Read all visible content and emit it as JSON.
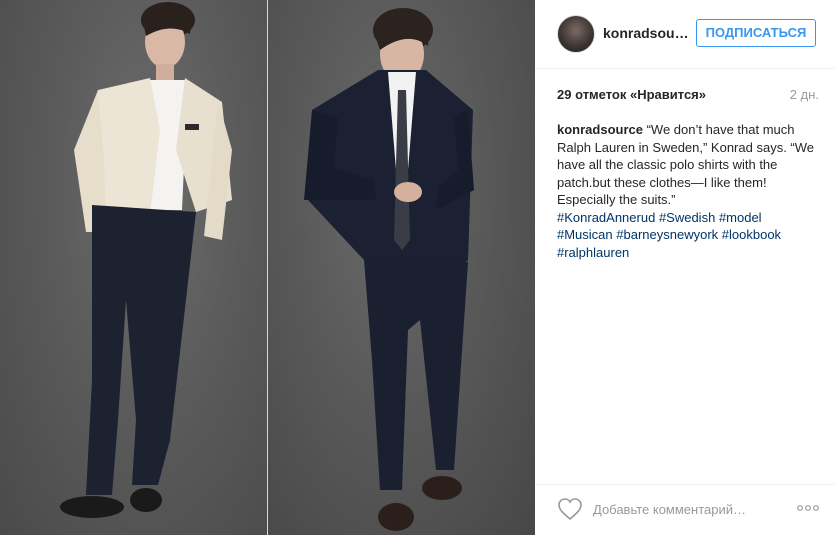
{
  "post": {
    "photo": {
      "description_left": "model-in-cream-blazer",
      "description_right": "model-in-navy-suit"
    }
  },
  "header": {
    "username": "konradsou…",
    "follow_label": "ПОДПИСАТЬСЯ"
  },
  "stats": {
    "likes": "29 отметок «Нравится»",
    "age": "2 дн."
  },
  "caption": {
    "user": "konradsource",
    "text": " “We don’t have that much Ralph Lauren in Sweden,” Konrad says. “We have all the classic polo shirts with the patch.but these clothes—I like them! Especially the suits.”",
    "hashtags": [
      "#KonradAnnerud",
      "#Swedish",
      "#model",
      "#Musican",
      "#barneysnewyork",
      "#lookbook",
      "#ralphlauren"
    ]
  },
  "footer": {
    "comment_placeholder": "Добавьте комментарий…",
    "like_icon": "heart-outline-icon",
    "more_icon": "more-options-icon"
  },
  "colors": {
    "accent": "#3897f0",
    "hashtag": "#003569",
    "muted": "#999999"
  }
}
